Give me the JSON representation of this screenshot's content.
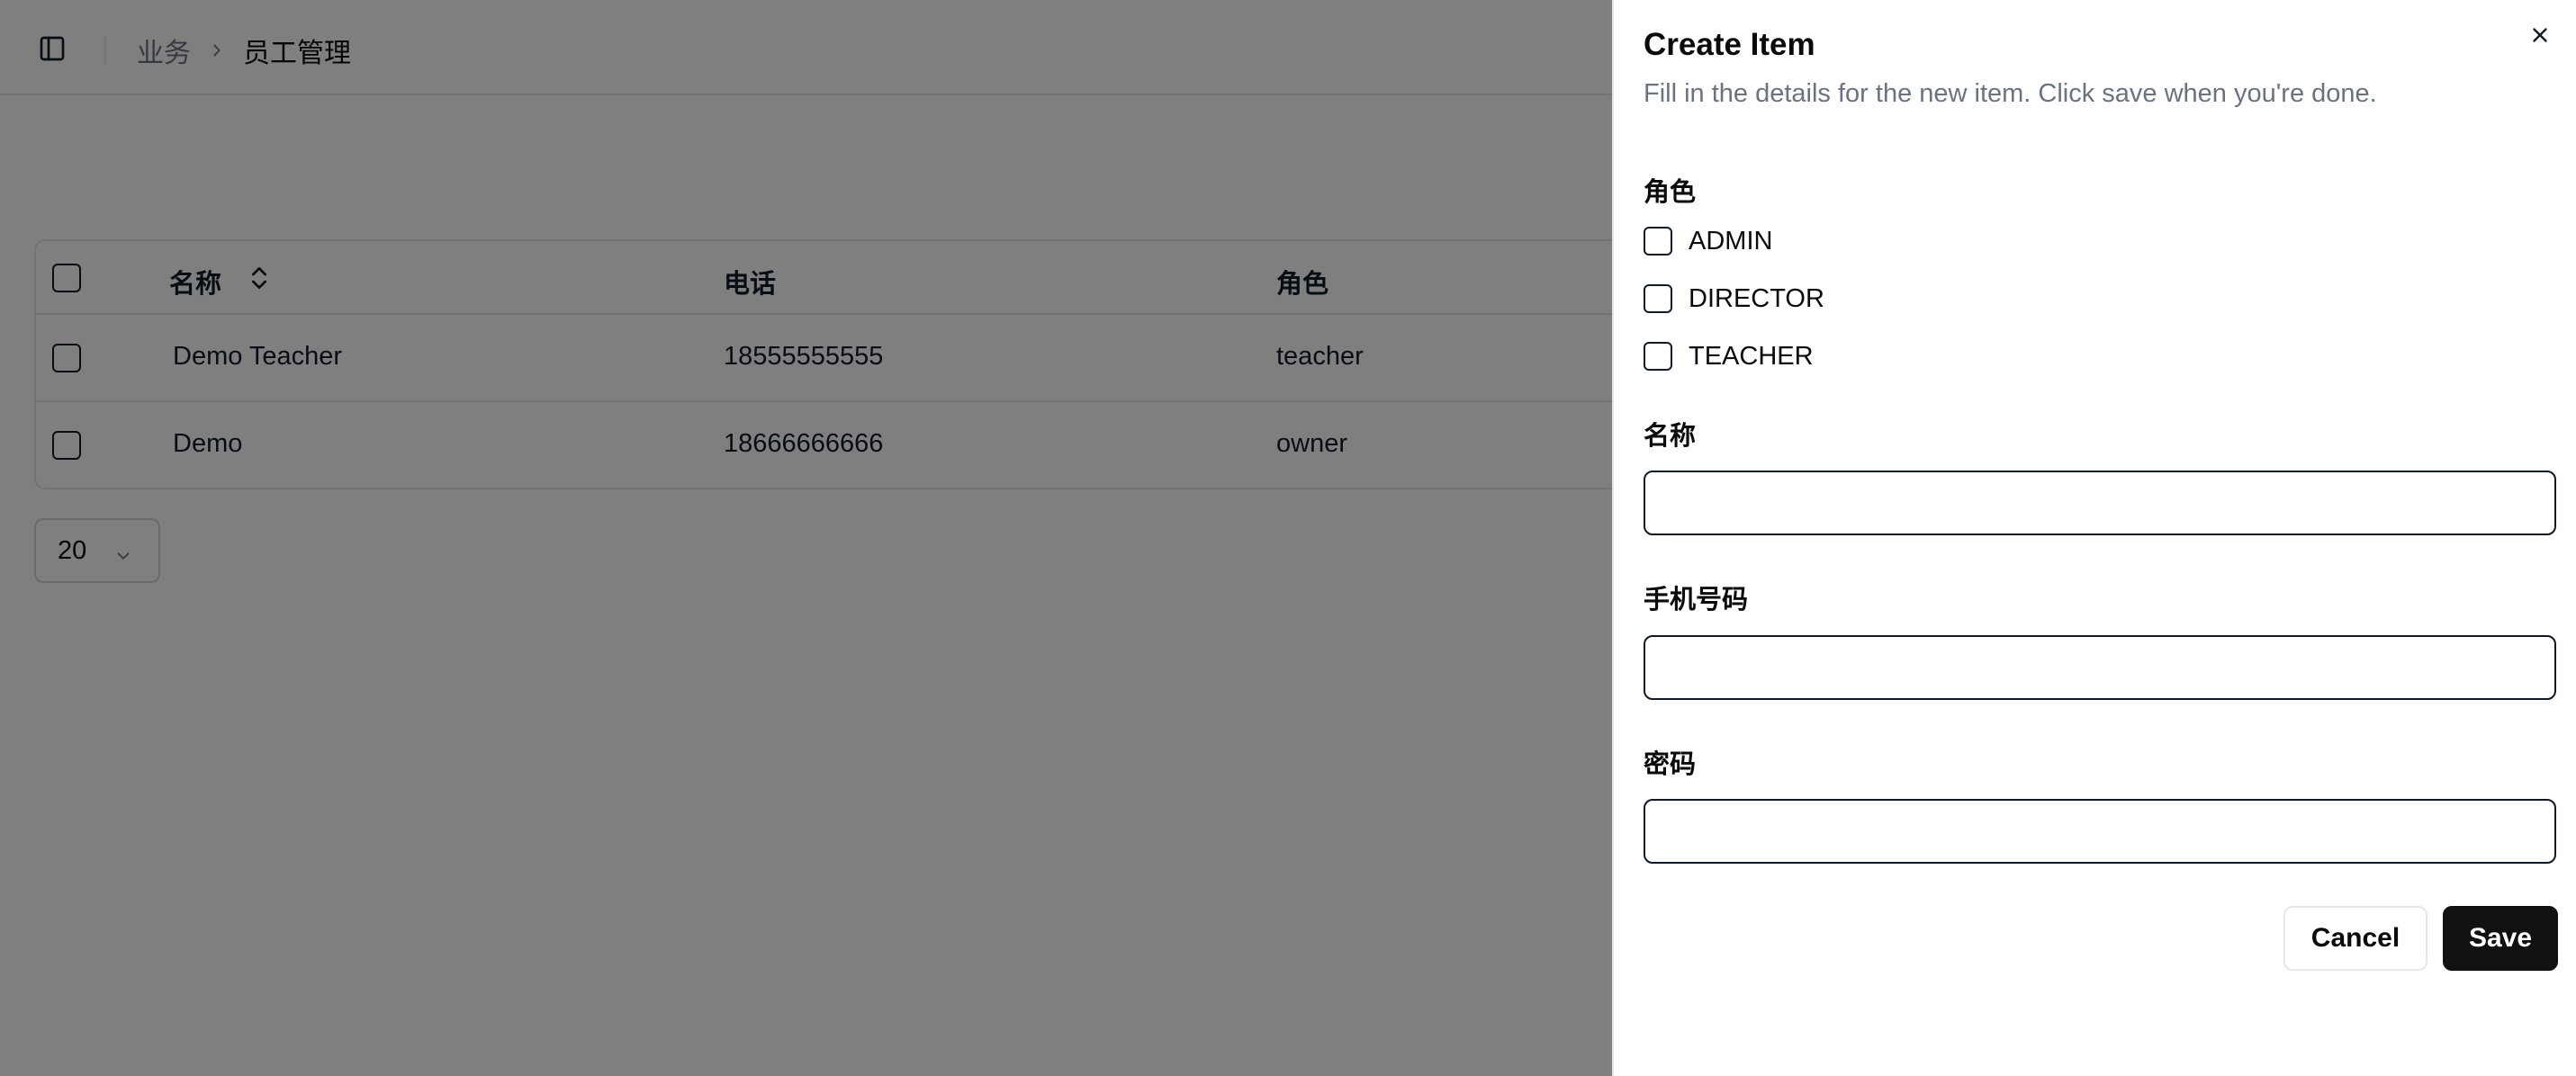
{
  "header": {
    "breadcrumb": {
      "parent": "业务",
      "current": "员工管理"
    }
  },
  "table": {
    "columns": {
      "name": "名称",
      "phone": "电话",
      "role": "角色"
    },
    "rows": [
      {
        "name": "Demo Teacher",
        "phone": "18555555555",
        "role": "teacher"
      },
      {
        "name": "Demo",
        "phone": "18666666666",
        "role": "owner"
      }
    ]
  },
  "pager": {
    "page_size": "20"
  },
  "sheet": {
    "title": "Create Item",
    "description": "Fill in the details for the new item. Click save when you're done.",
    "role_label": "角色",
    "roles": [
      "ADMIN",
      "DIRECTOR",
      "TEACHER"
    ],
    "name_label": "名称",
    "name_value": "",
    "phone_label": "手机号码",
    "phone_value": "",
    "password_label": "密码",
    "password_value": "",
    "cancel_label": "Cancel",
    "save_label": "Save"
  },
  "icons": {
    "sidebar_toggle": "panel-left-icon",
    "breadcrumb_separator": "chevron-right-icon",
    "sort": "chevrons-up-down-icon",
    "pager": "chevron-down-icon",
    "close": "close-icon"
  }
}
